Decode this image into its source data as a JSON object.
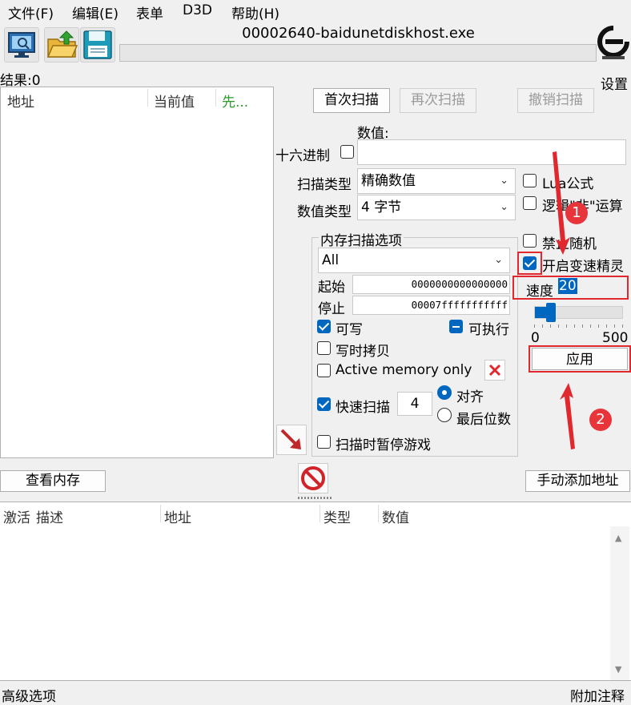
{
  "menu": [
    "文件(F)",
    "编辑(E)",
    "表单",
    "D3D",
    "帮助(H)"
  ],
  "process_title": "00002640-baidunetdiskhost.exe",
  "settings_label": "设置",
  "results_label": "结果:0",
  "results_columns": [
    "地址",
    "当前值",
    "先..."
  ],
  "scan_buttons": {
    "first": "首次扫描",
    "next": "再次扫描",
    "undo": "撤销扫描"
  },
  "value_label": "数值:",
  "hex_label": "十六进制",
  "value_input": "",
  "scan_type": {
    "label": "扫描类型",
    "value": "精确数值"
  },
  "value_type": {
    "label": "数值类型",
    "value": "4 字节"
  },
  "memory_options": {
    "title": "内存扫描选项",
    "region": "All",
    "start_label": "起始",
    "start_value": "0000000000000000",
    "stop_label": "停止",
    "stop_value": "00007fffffffffff",
    "writable": "可写",
    "executable": "可执行",
    "copy_on_write": "写时拷贝",
    "active_memory": "Active memory only",
    "fast_scan": "快速扫描",
    "fast_scan_value": "4",
    "align": "对齐",
    "last_digits": "最后位数",
    "pause_game": "扫描时暂停游戏"
  },
  "right_options": {
    "lua": "Lua公式",
    "logic_not": "逻辑\"非\"运算",
    "no_random": "禁止随机",
    "speedhack": "开启变速精灵",
    "speed_label": "速度",
    "speed_value": "20",
    "slider_min": "0",
    "slider_max": "500",
    "slider_level": 0.19,
    "apply": "应用"
  },
  "badges": [
    "1",
    "2"
  ],
  "view_memory": "查看内存",
  "add_address": "手动添加地址",
  "address_columns": [
    "激活",
    "描述",
    "地址",
    "类型",
    "数值"
  ],
  "footer": {
    "left": "高级选项",
    "right": "附加注释"
  },
  "colors": {
    "accent": "#0067c0",
    "annotation": "#e0282e"
  }
}
